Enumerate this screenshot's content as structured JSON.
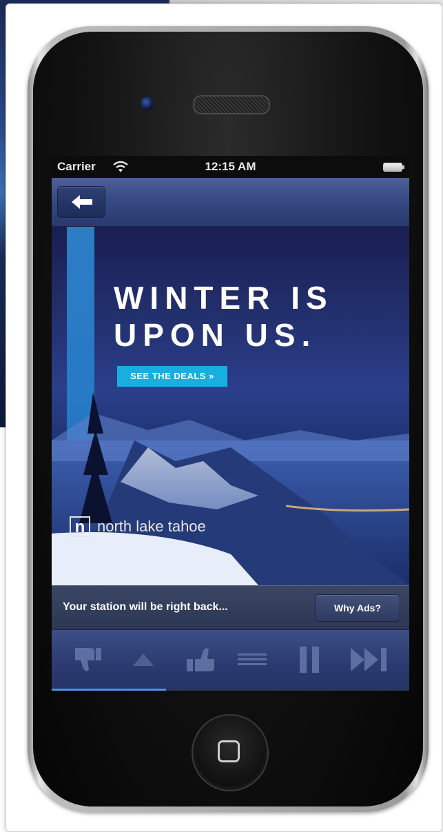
{
  "status_bar": {
    "carrier": "Carrier",
    "time": "12:15 AM"
  },
  "ad": {
    "headline": "WINTER IS\nUPON US.",
    "cta_label": "SEE THE DEALS »",
    "logo_letter": "n",
    "logo_text": "north lake tahoe",
    "stripe_color": "#2f8ed8",
    "cta_color": "#18aee0"
  },
  "info": {
    "message": "Your station will be right back...",
    "why_ads_label": "Why Ads?"
  },
  "controls": {
    "icons": [
      "thumbs-down-icon",
      "triangle-up-icon",
      "thumbs-up-icon",
      "menu-lines-icon",
      "pause-icon",
      "skip-forward-icon"
    ]
  },
  "playback": {
    "progress_fraction": 0.32
  },
  "theme": {
    "nav_color": "#33467e",
    "controls_color": "#2c3c72",
    "progress_color": "#4f8fe6"
  }
}
